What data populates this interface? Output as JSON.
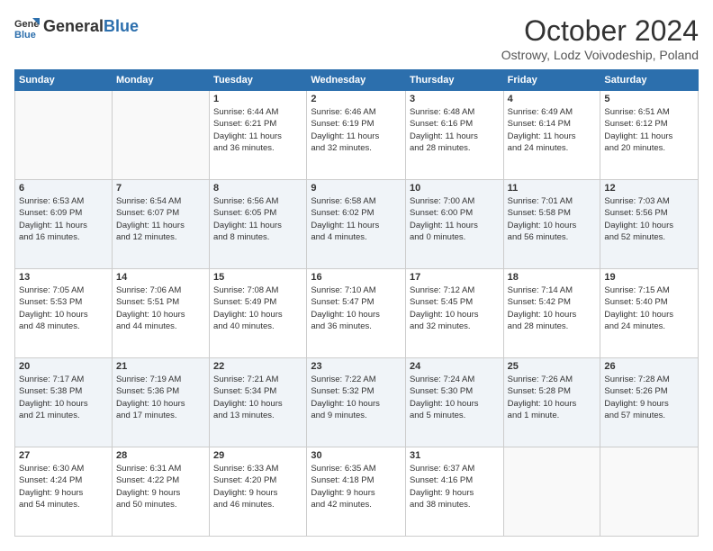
{
  "logo": {
    "general": "General",
    "blue": "Blue"
  },
  "header": {
    "month": "October 2024",
    "location": "Ostrowy, Lodz Voivodeship, Poland"
  },
  "weekdays": [
    "Sunday",
    "Monday",
    "Tuesday",
    "Wednesday",
    "Thursday",
    "Friday",
    "Saturday"
  ],
  "weeks": [
    [
      {
        "day": "",
        "info": ""
      },
      {
        "day": "",
        "info": ""
      },
      {
        "day": "1",
        "info": "Sunrise: 6:44 AM\nSunset: 6:21 PM\nDaylight: 11 hours\nand 36 minutes."
      },
      {
        "day": "2",
        "info": "Sunrise: 6:46 AM\nSunset: 6:19 PM\nDaylight: 11 hours\nand 32 minutes."
      },
      {
        "day": "3",
        "info": "Sunrise: 6:48 AM\nSunset: 6:16 PM\nDaylight: 11 hours\nand 28 minutes."
      },
      {
        "day": "4",
        "info": "Sunrise: 6:49 AM\nSunset: 6:14 PM\nDaylight: 11 hours\nand 24 minutes."
      },
      {
        "day": "5",
        "info": "Sunrise: 6:51 AM\nSunset: 6:12 PM\nDaylight: 11 hours\nand 20 minutes."
      }
    ],
    [
      {
        "day": "6",
        "info": "Sunrise: 6:53 AM\nSunset: 6:09 PM\nDaylight: 11 hours\nand 16 minutes."
      },
      {
        "day": "7",
        "info": "Sunrise: 6:54 AM\nSunset: 6:07 PM\nDaylight: 11 hours\nand 12 minutes."
      },
      {
        "day": "8",
        "info": "Sunrise: 6:56 AM\nSunset: 6:05 PM\nDaylight: 11 hours\nand 8 minutes."
      },
      {
        "day": "9",
        "info": "Sunrise: 6:58 AM\nSunset: 6:02 PM\nDaylight: 11 hours\nand 4 minutes."
      },
      {
        "day": "10",
        "info": "Sunrise: 7:00 AM\nSunset: 6:00 PM\nDaylight: 11 hours\nand 0 minutes."
      },
      {
        "day": "11",
        "info": "Sunrise: 7:01 AM\nSunset: 5:58 PM\nDaylight: 10 hours\nand 56 minutes."
      },
      {
        "day": "12",
        "info": "Sunrise: 7:03 AM\nSunset: 5:56 PM\nDaylight: 10 hours\nand 52 minutes."
      }
    ],
    [
      {
        "day": "13",
        "info": "Sunrise: 7:05 AM\nSunset: 5:53 PM\nDaylight: 10 hours\nand 48 minutes."
      },
      {
        "day": "14",
        "info": "Sunrise: 7:06 AM\nSunset: 5:51 PM\nDaylight: 10 hours\nand 44 minutes."
      },
      {
        "day": "15",
        "info": "Sunrise: 7:08 AM\nSunset: 5:49 PM\nDaylight: 10 hours\nand 40 minutes."
      },
      {
        "day": "16",
        "info": "Sunrise: 7:10 AM\nSunset: 5:47 PM\nDaylight: 10 hours\nand 36 minutes."
      },
      {
        "day": "17",
        "info": "Sunrise: 7:12 AM\nSunset: 5:45 PM\nDaylight: 10 hours\nand 32 minutes."
      },
      {
        "day": "18",
        "info": "Sunrise: 7:14 AM\nSunset: 5:42 PM\nDaylight: 10 hours\nand 28 minutes."
      },
      {
        "day": "19",
        "info": "Sunrise: 7:15 AM\nSunset: 5:40 PM\nDaylight: 10 hours\nand 24 minutes."
      }
    ],
    [
      {
        "day": "20",
        "info": "Sunrise: 7:17 AM\nSunset: 5:38 PM\nDaylight: 10 hours\nand 21 minutes."
      },
      {
        "day": "21",
        "info": "Sunrise: 7:19 AM\nSunset: 5:36 PM\nDaylight: 10 hours\nand 17 minutes."
      },
      {
        "day": "22",
        "info": "Sunrise: 7:21 AM\nSunset: 5:34 PM\nDaylight: 10 hours\nand 13 minutes."
      },
      {
        "day": "23",
        "info": "Sunrise: 7:22 AM\nSunset: 5:32 PM\nDaylight: 10 hours\nand 9 minutes."
      },
      {
        "day": "24",
        "info": "Sunrise: 7:24 AM\nSunset: 5:30 PM\nDaylight: 10 hours\nand 5 minutes."
      },
      {
        "day": "25",
        "info": "Sunrise: 7:26 AM\nSunset: 5:28 PM\nDaylight: 10 hours\nand 1 minute."
      },
      {
        "day": "26",
        "info": "Sunrise: 7:28 AM\nSunset: 5:26 PM\nDaylight: 9 hours\nand 57 minutes."
      }
    ],
    [
      {
        "day": "27",
        "info": "Sunrise: 6:30 AM\nSunset: 4:24 PM\nDaylight: 9 hours\nand 54 minutes."
      },
      {
        "day": "28",
        "info": "Sunrise: 6:31 AM\nSunset: 4:22 PM\nDaylight: 9 hours\nand 50 minutes."
      },
      {
        "day": "29",
        "info": "Sunrise: 6:33 AM\nSunset: 4:20 PM\nDaylight: 9 hours\nand 46 minutes."
      },
      {
        "day": "30",
        "info": "Sunrise: 6:35 AM\nSunset: 4:18 PM\nDaylight: 9 hours\nand 42 minutes."
      },
      {
        "day": "31",
        "info": "Sunrise: 6:37 AM\nSunset: 4:16 PM\nDaylight: 9 hours\nand 38 minutes."
      },
      {
        "day": "",
        "info": ""
      },
      {
        "day": "",
        "info": ""
      }
    ]
  ]
}
